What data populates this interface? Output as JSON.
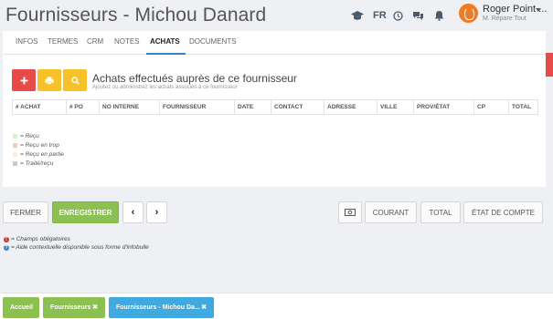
{
  "header": {
    "title": "Fournisseurs - Michou Danard",
    "language": "FR",
    "user_name": "Roger Point ...",
    "user_role": "M. Répare Tout"
  },
  "tabs": [
    {
      "label": "INFOS"
    },
    {
      "label": "TERMES"
    },
    {
      "label": "CRM"
    },
    {
      "label": "NOTES"
    },
    {
      "label": "ACHATS",
      "active": true
    },
    {
      "label": "DOCUMENTS"
    }
  ],
  "section": {
    "title": "Achats effectués auprès de ce fournisseur",
    "subtitle": "Ajoutez ou administrez les achats associés à ce fournisseur"
  },
  "table": {
    "columns": [
      "# ACHAT",
      "# PO",
      "NO INTERNE",
      "FOURNISSEUR",
      "DATE",
      "CONTACT",
      "ADRESSE",
      "VILLE",
      "PROV/ÉTAT",
      "CP",
      "TOTAL"
    ],
    "rows": []
  },
  "legend": [
    {
      "label": "= Reçu",
      "color": "#d6f0c8"
    },
    {
      "label": "= Reçu en trop",
      "color": "#f6c9c4"
    },
    {
      "label": "= Reçu en partie",
      "color": "#fbeede"
    },
    {
      "label": "= Traité/reçu",
      "color": "#c9c9c9"
    }
  ],
  "actions": {
    "close": "FERMER",
    "save": "ENREGISTRER",
    "prev": "‹",
    "next": "›",
    "current": "COURANT",
    "total": "TOTAL",
    "statement": "ÉTAT DE COMPTE"
  },
  "notes": {
    "required": "= Champs obligatoires",
    "help": "= Aide contextuelle disponible sous forme d'infobulle"
  },
  "help_tab": "?",
  "bottom_tabs": [
    {
      "label": "Accueil"
    },
    {
      "label": "Fournisseurs"
    },
    {
      "label": "Fournisseurs - Michou Da..."
    }
  ],
  "colors": {
    "accent_blue": "#3a82c4",
    "green": "#8cc152",
    "red": "#e84a4a",
    "yellow": "#f7c12a",
    "light_blue": "#3fa9e0"
  }
}
